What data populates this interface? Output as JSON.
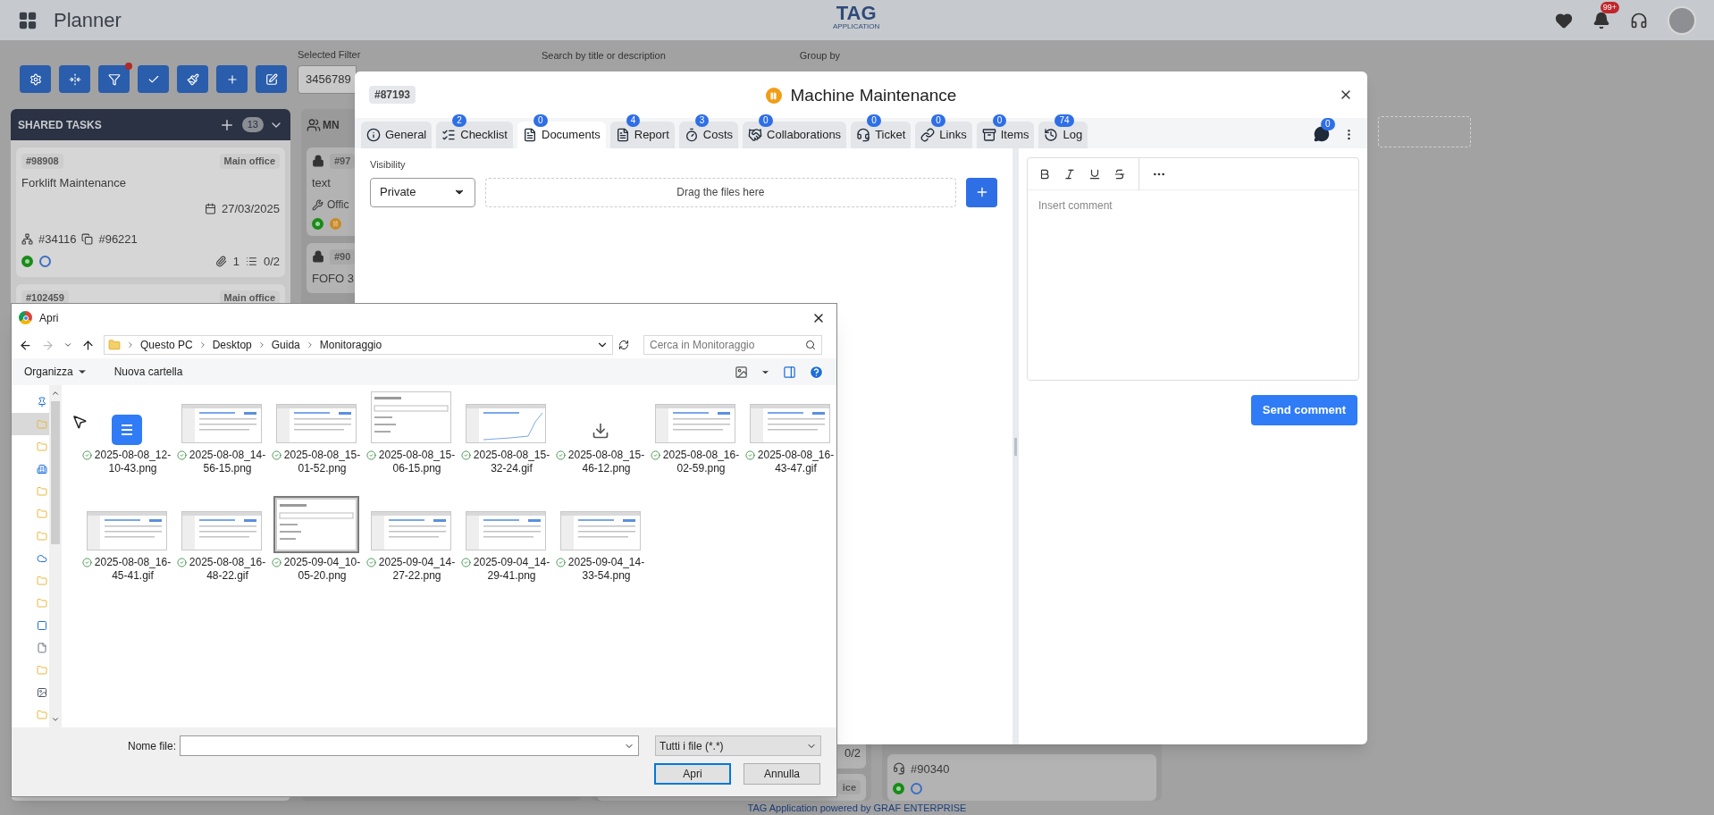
{
  "app": {
    "title": "Planner",
    "logo": "TAG",
    "logo_sub": "APPLICATION",
    "notifications": "99+"
  },
  "toolbar": [
    {
      "kind": "settings",
      "alert": false
    },
    {
      "kind": "collapse",
      "alert": false
    },
    {
      "kind": "filter",
      "alert": true
    },
    {
      "kind": "check",
      "alert": false
    },
    {
      "kind": "brush",
      "alert": false
    },
    {
      "kind": "add",
      "alert": false
    },
    {
      "kind": "edit",
      "alert": false
    }
  ],
  "filters": [
    {
      "label": "Selected Filter",
      "value": "3456789"
    },
    {
      "label": "Search by title or description"
    },
    {
      "label": "Group by"
    }
  ],
  "columns": [
    {
      "title": "SHARED TASKS",
      "count": "13",
      "cards": [
        {
          "id": "#98908",
          "location": "Main office",
          "title": "Forklift Maintenance",
          "date": "27/03/2025",
          "parent": "#34116",
          "copy": "#96221",
          "attachments": "1",
          "checklist": "0/2",
          "statuses": [
            {
              "kind": "active"
            },
            {
              "kind": "open"
            }
          ]
        },
        {
          "id": "#102459",
          "location": "Main office"
        }
      ]
    },
    {
      "title": "MN",
      "cards": [
        {
          "locked": true,
          "id": "#97",
          "title": "text",
          "place": "Offic",
          "statuses": [
            {
              "kind": "active"
            },
            {
              "kind": "paused"
            }
          ]
        },
        {
          "locked": true,
          "id": "#90",
          "title": "FOFO 3"
        }
      ]
    },
    {
      "cards": [
        {
          "checklist": "0/2"
        },
        {
          "location": "ice"
        }
      ]
    },
    {
      "cards": [
        {
          "ticket": "#90340",
          "statuses": [
            {
              "kind": "active"
            },
            {
              "kind": "open"
            }
          ]
        }
      ]
    }
  ],
  "modal": {
    "id": "#87193",
    "title": "Machine Maintenance",
    "tabs": [
      {
        "label": "General",
        "selected": false
      },
      {
        "label": "Checklist",
        "badge": "2",
        "selected": false
      },
      {
        "label": "Documents",
        "badge": "0",
        "selected": true
      },
      {
        "label": "Report",
        "badge": "4",
        "selected": false
      },
      {
        "label": "Costs",
        "badge": "3",
        "selected": false
      },
      {
        "label": "Collaborations",
        "badge": "0",
        "selected": false
      },
      {
        "label": "Ticket",
        "badge": "0",
        "selected": false
      },
      {
        "label": "Links",
        "badge": "0",
        "selected": false
      },
      {
        "label": "Items",
        "badge": "0",
        "selected": false
      },
      {
        "label": "Log",
        "badge": "74",
        "selected": false
      }
    ],
    "comments_badge": "0",
    "visibility": {
      "label": "Visibility",
      "value": "Private"
    },
    "dropzone": "Drag the files here",
    "editor": {
      "placeholder": "Insert comment",
      "button": "Send comment"
    }
  },
  "dialog": {
    "title": "Apri",
    "path": [
      "Questo PC",
      "Desktop",
      "Guida",
      "Monitoraggio"
    ],
    "search_placeholder": "Cerca in Monitoraggio",
    "commands": [
      {
        "label": "Organizza",
        "menu": true
      },
      {
        "label": "Nuova cartella",
        "menu": false
      }
    ],
    "nav_pane": [
      {
        "kind": "pin",
        "selected": false
      },
      {
        "kind": "folder",
        "selected": true
      },
      {
        "kind": "folder",
        "selected": false
      },
      {
        "kind": "building",
        "selected": false
      },
      {
        "kind": "folder",
        "selected": false
      },
      {
        "kind": "folder",
        "selected": false
      },
      {
        "kind": "folder",
        "selected": false
      },
      {
        "kind": "cloud",
        "selected": false
      },
      {
        "kind": "folder",
        "selected": false
      },
      {
        "kind": "folder",
        "selected": false
      },
      {
        "kind": "square",
        "selected": false
      },
      {
        "kind": "file",
        "selected": false
      },
      {
        "kind": "folder",
        "selected": false
      },
      {
        "kind": "image",
        "selected": false
      },
      {
        "kind": "folder",
        "selected": false
      }
    ],
    "files": [
      {
        "name": "2025-08-08_12-10-43.png",
        "kind": "document",
        "selected": false
      },
      {
        "name": "2025-08-08_14-56-15.png",
        "kind": "screen",
        "selected": false
      },
      {
        "name": "2025-08-08_15-01-52.png",
        "kind": "screen",
        "selected": false
      },
      {
        "name": "2025-08-08_15-06-15.png",
        "kind": "popup",
        "selected": false
      },
      {
        "name": "2025-08-08_15-32-24.gif",
        "kind": "chart",
        "selected": false
      },
      {
        "name": "2025-08-08_15-46-12.png",
        "kind": "installer",
        "selected": false
      },
      {
        "name": "2025-08-08_16-02-59.png",
        "kind": "screen",
        "selected": false
      },
      {
        "name": "2025-08-08_16-43-47.gif",
        "kind": "screen",
        "selected": false
      },
      {
        "name": "2025-08-08_16-45-41.gif",
        "kind": "screen",
        "selected": false
      },
      {
        "name": "2025-08-08_16-48-22.gif",
        "kind": "screen",
        "selected": false
      },
      {
        "name": "2025-09-04_10-05-20.png",
        "kind": "popup",
        "selected": true
      },
      {
        "name": "2025-09-04_14-27-22.png",
        "kind": "screen",
        "selected": false
      },
      {
        "name": "2025-09-04_14-29-41.png",
        "kind": "screen",
        "selected": false
      },
      {
        "name": "2025-09-04_14-33-54.png",
        "kind": "screen",
        "selected": false
      }
    ],
    "filename_label": "Nome file:",
    "filetype": "Tutti i file (*.*)",
    "buttons": [
      "Apri",
      "Annulla"
    ]
  },
  "footer": "TAG Application powered by GRAF ENTERPRISE"
}
